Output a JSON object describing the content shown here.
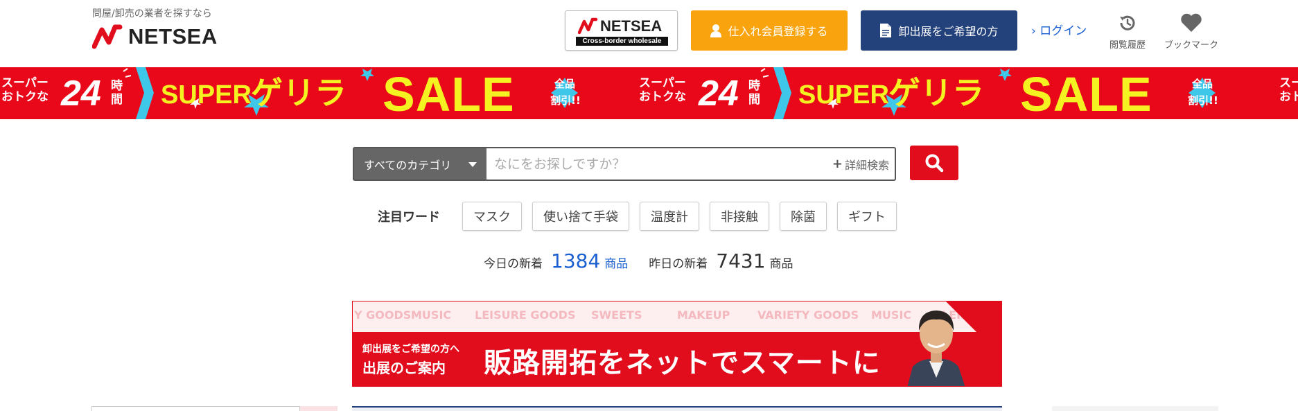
{
  "header": {
    "tagline": "問屋/卸売の業者を探すなら",
    "logo_text": "NETSEA",
    "crossborder": {
      "name": "NETSEA",
      "sub": "Cross-border wholesale"
    },
    "register_label": "仕入れ会員登録する",
    "exhibit_label": "卸出展をご希望の方",
    "login_label": "ログイン",
    "history_label": "閲覧履歴",
    "bookmark_label": "ブックマーク"
  },
  "sale_banner": {
    "lead_line1": "スーパー",
    "lead_line2": "おトクな",
    "hours_num": "24",
    "hours_unit": "時間",
    "super": "SUPER",
    "guerrilla": "ゲリラ",
    "sale": "SALE",
    "badge1": "全品",
    "badge2": "割引!!"
  },
  "search": {
    "category_label": "すべてのカテゴリ",
    "placeholder": "なにをお探しですか？",
    "advanced_label": "詳細検索"
  },
  "keywords": {
    "title": "注目ワード",
    "items": [
      "マスク",
      "使い捨て手袋",
      "温度計",
      "非接触",
      "除菌",
      "ギフト"
    ]
  },
  "counts": {
    "today_label": "今日の新着",
    "today_value": "1384",
    "yesterday_label": "昨日の新着",
    "yesterday_value": "7431",
    "unit": "商品"
  },
  "exhibit_banner": {
    "categories": [
      "Y GOODS",
      "MUSIC",
      "LEISURE GOODS",
      "SWEETS",
      "MAKEUP",
      "VARIETY GOODS",
      "MUSIC",
      "LEISURE G"
    ],
    "line1": "卸出展をご希望の方へ",
    "line2": "出展のご案内",
    "headline": "販路開拓をネットでスマートに"
  },
  "colors": {
    "brand_red": "#e10d1d",
    "register_orange": "#f9a40e",
    "exhibit_navy": "#23417b",
    "link_blue": "#1a5fd0",
    "sale_yellow": "#f5f222",
    "sale_cyan": "#3fc7ea"
  },
  "icons": {
    "register": "person-icon",
    "exhibit": "document-icon",
    "login": "chevron-right-icon",
    "history": "history-icon",
    "bookmark": "heart-icon",
    "search": "magnifier-icon",
    "advanced": "plus-icon"
  }
}
